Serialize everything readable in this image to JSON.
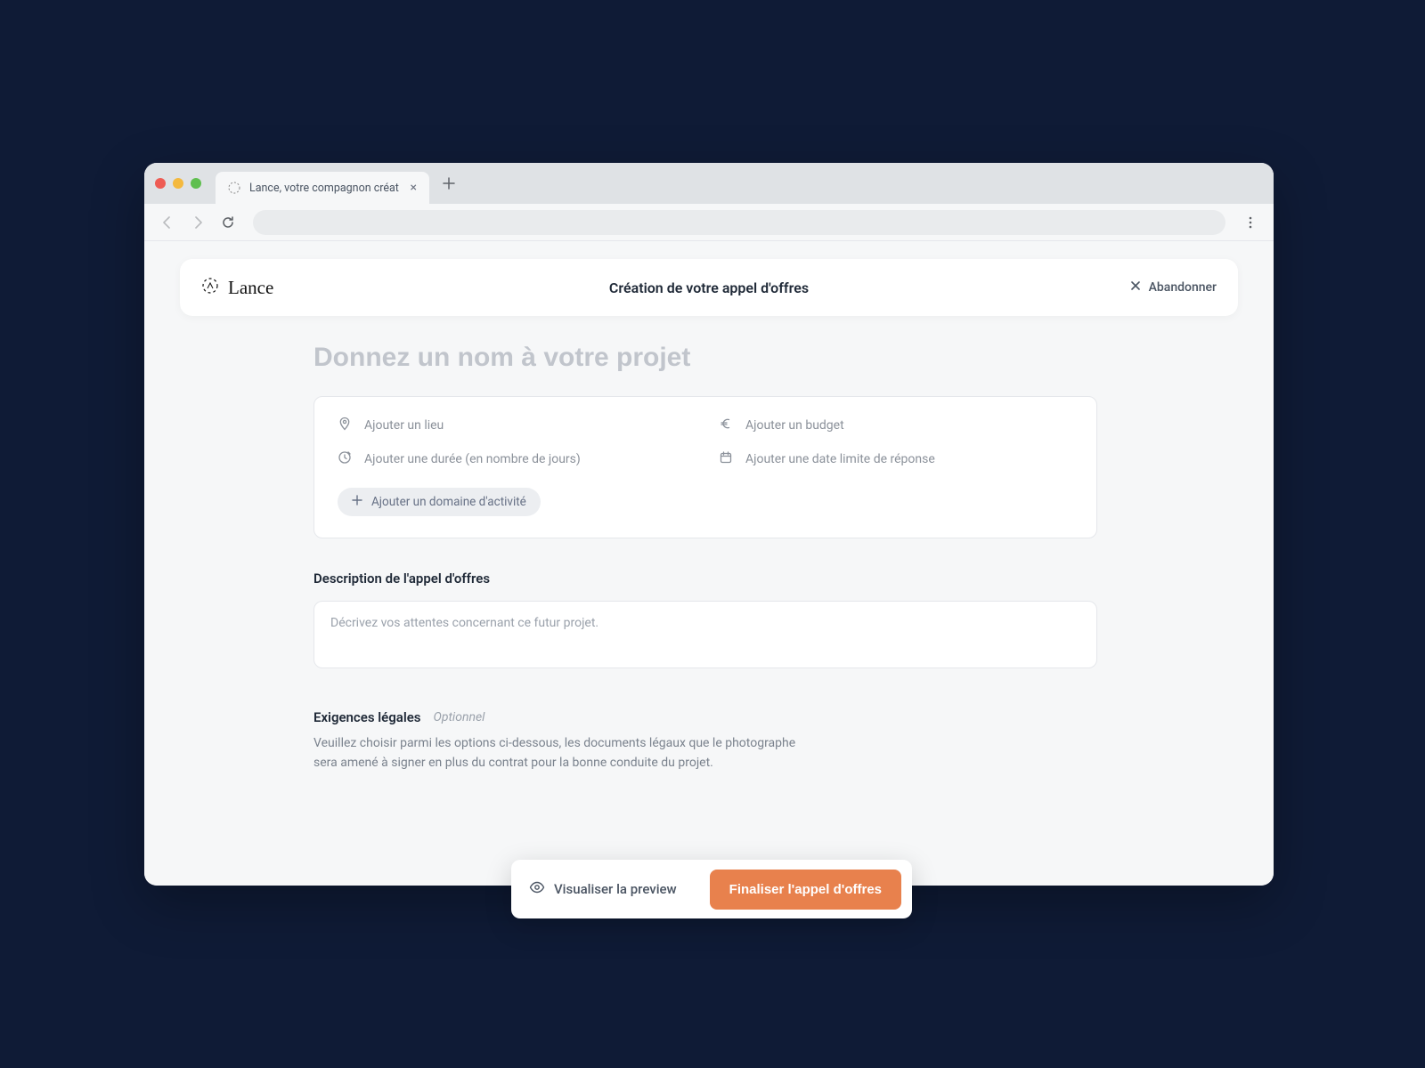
{
  "browser": {
    "tab_title": "Lance, votre compagnon créat",
    "tab_close_glyph": "×",
    "new_tab_glyph": "+"
  },
  "brand": {
    "name": "Lance"
  },
  "header": {
    "title": "Création de votre appel d'offres",
    "abandon_label": "Abandonner"
  },
  "project_name": {
    "placeholder": "Donnez un nom à votre projet"
  },
  "meta": {
    "location_label": "Ajouter un lieu",
    "budget_label": "Ajouter un budget",
    "duration_label": "Ajouter une durée (en nombre de jours)",
    "deadline_label": "Ajouter une date limite de réponse",
    "domain_label": "Ajouter un domaine d'activité"
  },
  "description": {
    "heading": "Description de l'appel d'offres",
    "placeholder": "Décrivez vos attentes concernant ce futur projet."
  },
  "legal": {
    "heading": "Exigences légales",
    "optional_label": "Optionnel",
    "help_text": "Veuillez choisir parmi les options ci-dessous, les documents légaux que le photographe sera amené à signer en plus du contrat pour la bonne conduite du projet."
  },
  "floating_bar": {
    "preview_label": "Visualiser la preview",
    "finalize_label": "Finaliser l'appel d'offres"
  }
}
